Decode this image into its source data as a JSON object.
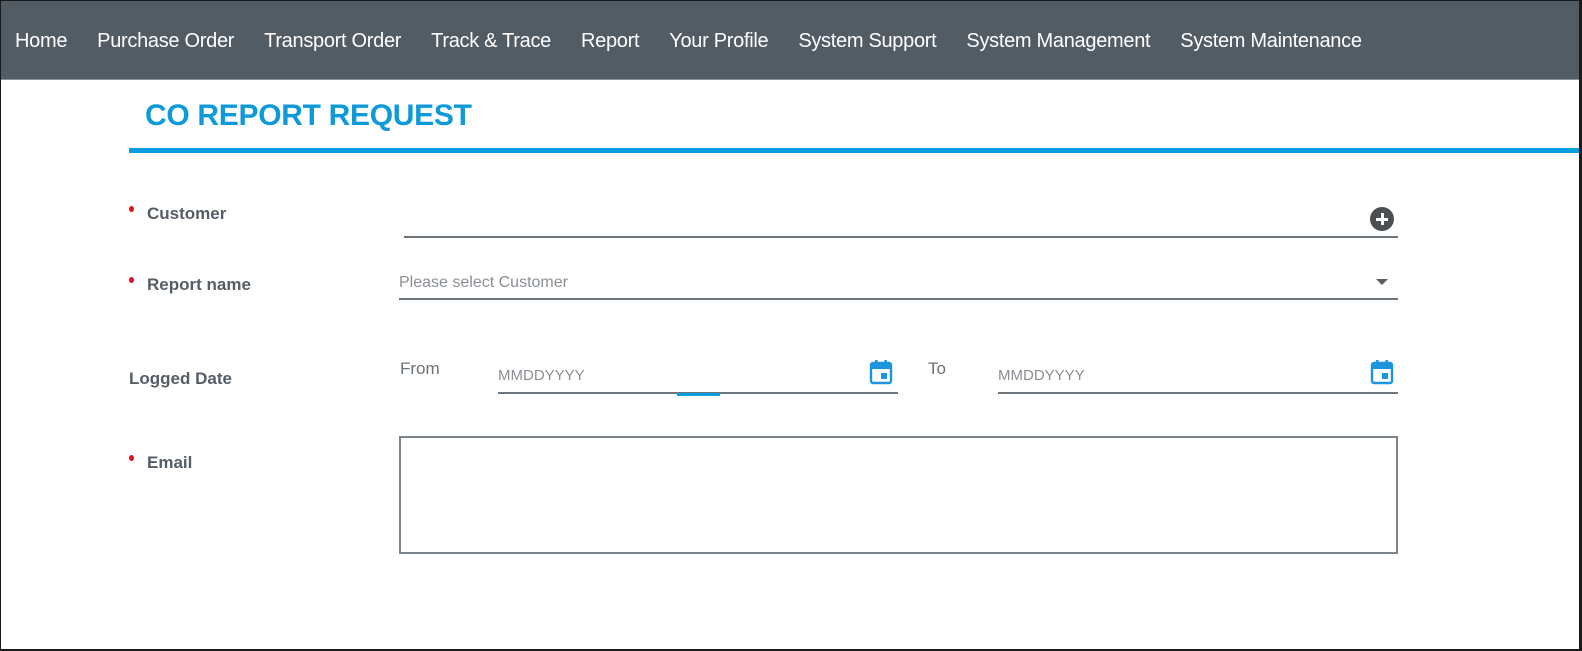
{
  "navbar": {
    "items": [
      {
        "label": "Home"
      },
      {
        "label": "Purchase Order"
      },
      {
        "label": "Transport Order"
      },
      {
        "label": "Track & Trace"
      },
      {
        "label": "Report"
      },
      {
        "label": "Your Profile"
      },
      {
        "label": "System Support"
      },
      {
        "label": "System Management"
      },
      {
        "label": "System Maintenance"
      }
    ]
  },
  "page": {
    "title": "CO REPORT REQUEST"
  },
  "form": {
    "customer": {
      "label": "Customer",
      "required": true,
      "value": "",
      "add_icon": "plus-circle-icon"
    },
    "report_name": {
      "label": "Report name",
      "required": true,
      "placeholder": "Please select Customer",
      "dropdown_icon": "caret-down-icon"
    },
    "logged_date": {
      "label": "Logged Date",
      "required": false,
      "from_label": "From",
      "from_placeholder": "MMDDYYYY",
      "to_label": "To",
      "to_placeholder": "MMDDYYYY",
      "calendar_icon": "calendar-icon"
    },
    "email": {
      "label": "Email",
      "required": true,
      "value": ""
    }
  },
  "colors": {
    "navbar_bg": "#525c65",
    "accent": "#0a9de0",
    "title": "#0e9ad8",
    "required_dot": "#e0101b",
    "label": "#555d66"
  }
}
